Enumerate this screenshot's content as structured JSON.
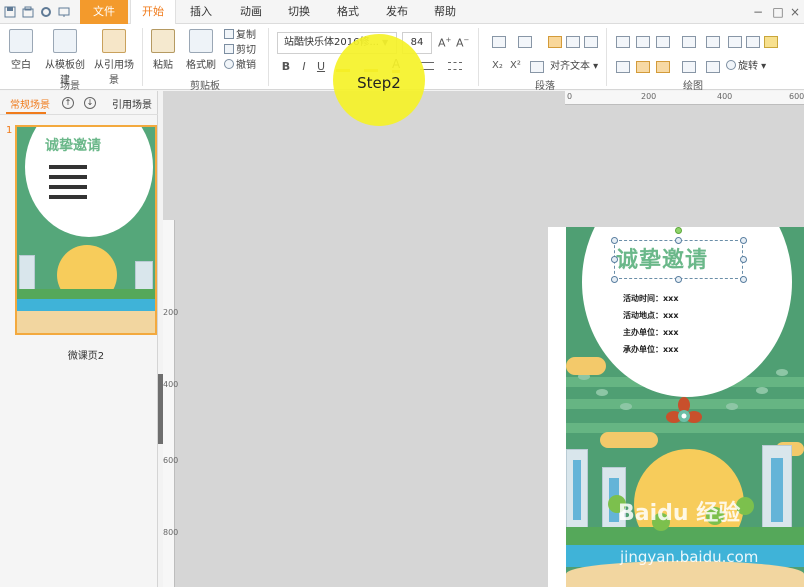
{
  "menu": {
    "file": "文件",
    "tabs": [
      "开始",
      "插入",
      "动画",
      "切换",
      "格式",
      "发布",
      "帮助"
    ]
  },
  "ribbon": {
    "scene": {
      "blank": "空白",
      "from_template": "从模板创建",
      "from_ref": "从引用场景",
      "group": "场景"
    },
    "clipboard": {
      "paste": "粘贴",
      "format_painter": "格式刷",
      "copy": "复制",
      "cut": "剪切",
      "undo": "撤销",
      "group": "剪贴板"
    },
    "font": {
      "family": "站酷快乐体2016修...",
      "size": "84"
    },
    "paragraph": {
      "align_text": "对齐文本",
      "group": "段落"
    },
    "drawing": {
      "rotate": "旋转",
      "group": "绘图"
    }
  },
  "annotation": {
    "step": "Step2"
  },
  "left_panel": {
    "tab_common": "常规场景",
    "tab_ref": "引用场景",
    "slide_number": "1",
    "slide_label": "微课页2"
  },
  "ruler": {
    "top_ticks": [
      "0",
      "200",
      "400",
      "600"
    ],
    "left_ticks": [
      "200",
      "400",
      "600",
      "800"
    ]
  },
  "poster": {
    "title": "诚挚邀请",
    "info": [
      "活动时间：xxx",
      "活动地点：xxx",
      "主办单位：xxx",
      "承办单位：xxx"
    ]
  },
  "thumb": {
    "title": "诚挚邀请"
  },
  "watermark": {
    "brand": "Baidu 经验",
    "url": "jingyan.baidu.com"
  },
  "colors": {
    "accent": "#f07b1b",
    "file_tab": "#f39a2c",
    "poster_green": "#4f9f73",
    "highlight": "#f5f228"
  }
}
